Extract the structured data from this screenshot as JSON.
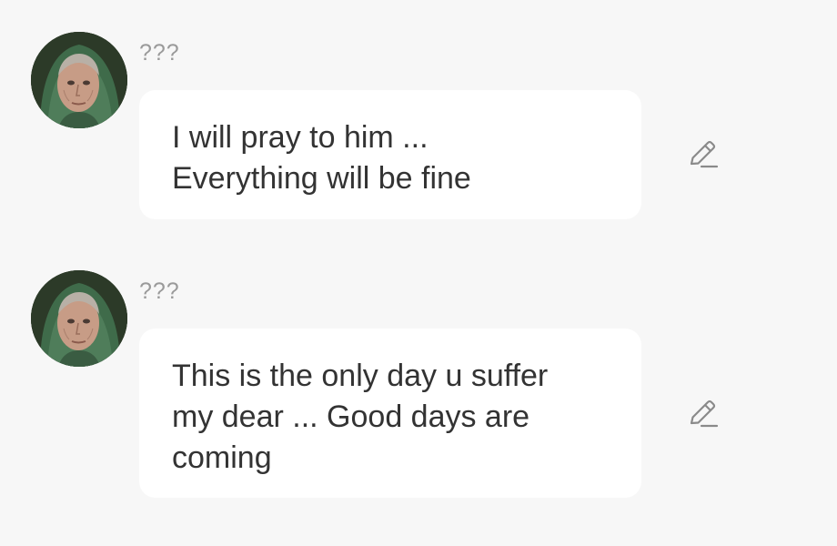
{
  "messages": [
    {
      "sender": "???",
      "text": "I will pray to him ...\nEverything will be fine"
    },
    {
      "sender": "???",
      "text": "This is the only day u suffer\nmy dear ... Good days are\ncoming"
    }
  ],
  "icons": {
    "edit": "pencil-icon",
    "avatar": "old-woman-portrait"
  },
  "colors": {
    "background": "#f7f7f7",
    "bubble": "#ffffff",
    "text": "#333333",
    "sender": "#9a9a9a",
    "icon": "#8a8a8a"
  }
}
